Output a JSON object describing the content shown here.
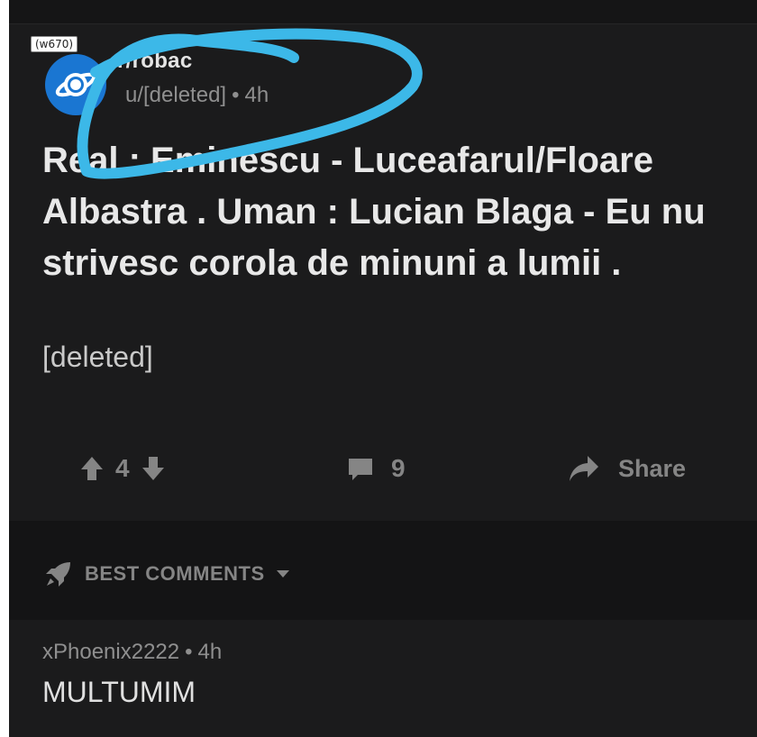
{
  "image_tag": "(w670)",
  "post": {
    "subreddit": "r/robac",
    "author": "u/[deleted]",
    "time": "4h",
    "title": "Real : Eminescu - Luceafarul/Floare Albastra . Uman : Lucian Blaga - Eu nu strivesc corola de minuni a lumii .",
    "body": "[deleted]"
  },
  "actions": {
    "score": "4",
    "comments": "9",
    "share_label": "Share"
  },
  "sort": {
    "label": "BEST COMMENTS"
  },
  "comment": {
    "author": "xPhoenix2222",
    "time": "4h",
    "body": "MULTUMIM"
  },
  "colors": {
    "background": "#1b1b1c",
    "accent_blue": "#1a76d2",
    "highlight_circle": "#3cb8e8",
    "muted_text": "#858585"
  },
  "icons": [
    "planet-icon",
    "upvote-icon",
    "downvote-icon",
    "comment-icon",
    "share-icon",
    "rocket-icon",
    "chevron-down-icon"
  ]
}
